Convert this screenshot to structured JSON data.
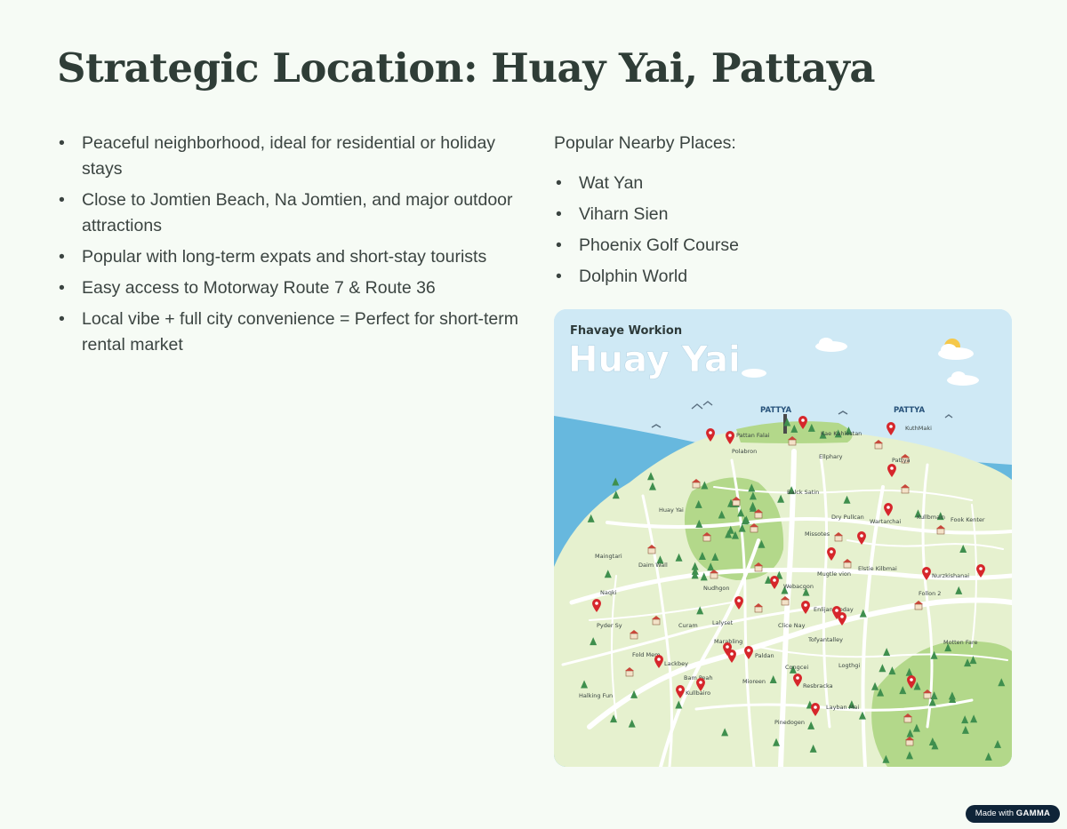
{
  "slide": {
    "title": "Strategic Location: Huay Yai, Pattaya",
    "bullets": [
      "Peaceful neighborhood, ideal for residential or holiday stays",
      "Close to Jomtien Beach, Na Jomtien, and major outdoor attractions",
      "Popular with long-term expats and short-stay tourists",
      "Easy access to Motorway Route 7 & Route 36",
      "Local vibe + full city convenience = Perfect for short-term rental market"
    ],
    "nearby_heading": "Popular Nearby Places:",
    "nearby_places": [
      "Wat Yan",
      "Viharn Sien",
      "Phoenix Golf Course",
      "Dolphin World"
    ]
  },
  "map": {
    "subtitle": "Fhavaye Workion",
    "title": "Huay Yai",
    "region_labels": [
      "PATTYA",
      "PATTYA"
    ],
    "place_labels": [
      "Pattan Falai",
      "Kae Kahlestan",
      "KuthMaki",
      "Polabron",
      "Ellphary",
      "Pattya",
      "Huay Yai",
      "Balck Satin",
      "Kullbmain",
      "Fook Kenter",
      "Dry Pullcan",
      "Wartarchai",
      "Maingtari",
      "Daim Wall",
      "Missotes",
      "Elstie Kilbmai",
      "Nurzkishanai",
      "Nudhgon",
      "Webacgon",
      "Mugtle vion",
      "Follon 2",
      "Naqki",
      "Pyder Sy",
      "Curam",
      "Lalyset",
      "Enlijan Doday",
      "Clice Nay",
      "Tofyantalley",
      "Motten Fare",
      "Marabling",
      "Paldan",
      "Lackbey",
      "Fold Mem",
      "Congcei",
      "Logthgi",
      "Bam Peah",
      "Kullbairo",
      "Mioreen",
      "Resbracka",
      "Layban Mai",
      "Halking Fun",
      "Pinedogen"
    ]
  },
  "colors": {
    "background": "#f6fbf5",
    "title": "#2f3d37",
    "text": "#3b4441",
    "land": "#e6f1cf",
    "park": "#b3d88a",
    "sea": "#67b8de",
    "sky": "#cfe9f5",
    "road": "#ffffff",
    "pin": "#d6262b"
  },
  "badge": {
    "prefix": "Made with",
    "brand": "GAMMA"
  }
}
